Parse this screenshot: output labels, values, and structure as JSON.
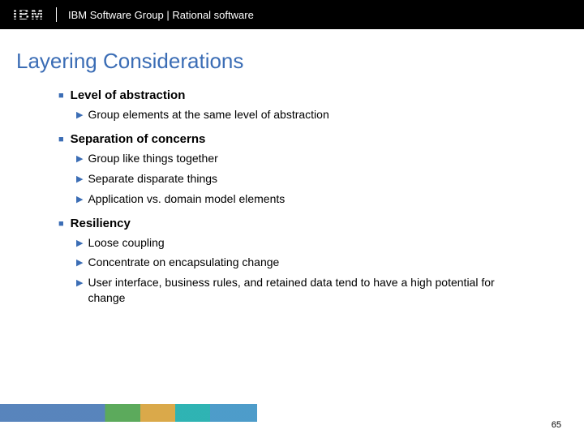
{
  "header": {
    "logo_text": "IBM",
    "group_text": "IBM Software Group | Rational software"
  },
  "slide": {
    "title": "Layering Considerations",
    "sections": [
      {
        "heading": "Level of abstraction",
        "items": [
          "Group elements at the same level of abstraction"
        ]
      },
      {
        "heading": "Separation of concerns",
        "items": [
          "Group like things together",
          "Separate disparate things",
          "Application vs. domain model elements"
        ]
      },
      {
        "heading": "Resiliency",
        "items": [
          "Loose coupling",
          "Concentrate on encapsulating change",
          "User interface, business rules, and retained data tend to have a high potential for change"
        ]
      }
    ]
  },
  "footer": {
    "page_number": "65"
  }
}
